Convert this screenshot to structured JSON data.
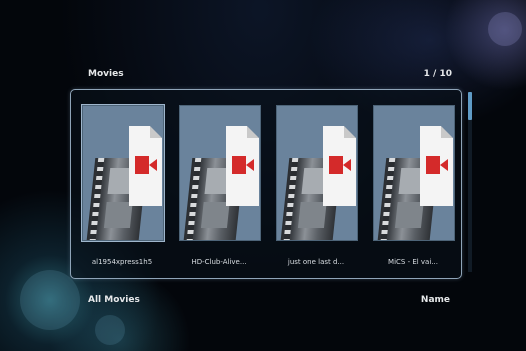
{
  "header": {
    "title": "Movies",
    "page_counter": "1 / 10"
  },
  "items": [
    {
      "label": "al1954xpress1h5",
      "icon": "video-file-icon"
    },
    {
      "label": "HD-Club-Alive...",
      "icon": "video-file-icon"
    },
    {
      "label": "just one last d...",
      "icon": "video-file-icon"
    },
    {
      "label": "MiCS - El vai...",
      "icon": "video-file-icon"
    }
  ],
  "footer": {
    "left_label": "All Movies",
    "right_label": "Name"
  },
  "colors": {
    "accent": "#5f9bc6",
    "tile_bg": "#6a839c",
    "camera_red": "#d42a2a"
  }
}
